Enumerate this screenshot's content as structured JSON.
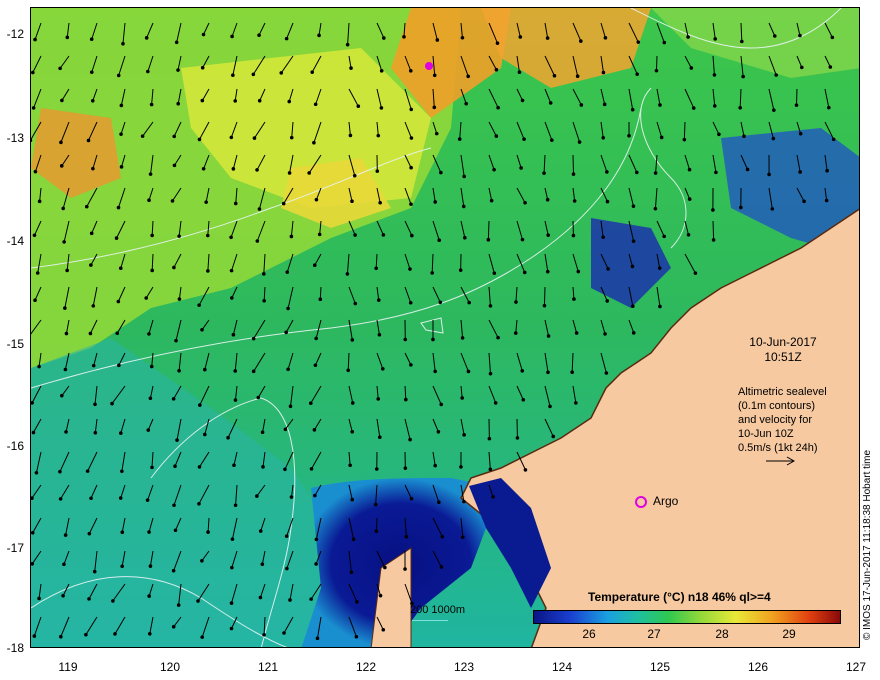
{
  "map": {
    "y_labels": [
      "-12",
      "-13",
      "-14",
      "-15",
      "-16",
      "-17",
      "-18"
    ],
    "x_labels": [
      "119",
      "120",
      "121",
      "122",
      "123",
      "124",
      "125",
      "126",
      "127"
    ],
    "date": "10-Jun-2017",
    "time": "10:51Z",
    "altimetry_lines": [
      "Altimetric sealevel",
      "(0.1m contours)",
      "and velocity for",
      "10-Jun 10Z",
      "0.5m/s (1kt 24h)"
    ],
    "argo_label": "Argo",
    "scale_label": "200  1000m",
    "colorbar_title": "Temperature (°C) n18 46% ql>=4",
    "colorbar_ticks": [
      "26",
      "27",
      "28",
      "29"
    ],
    "credit": "© IMOS 17-Jun-2017 11:18:38 Hobart time"
  },
  "colors": {
    "land": "#f6c9a0",
    "sst_cold": "#0a1585",
    "sst_mid": "#1fbf55",
    "sst_warm": "#f0a020",
    "argo": "#e000e0"
  }
}
